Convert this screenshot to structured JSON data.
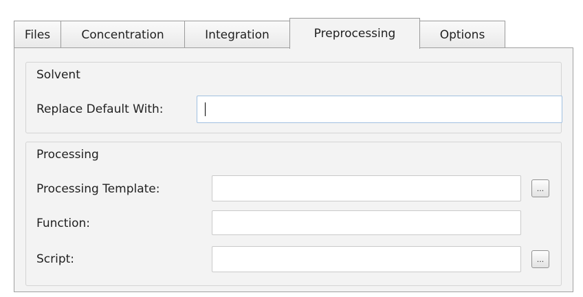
{
  "tabs": [
    {
      "label": "Files",
      "active": false
    },
    {
      "label": "Concentration",
      "active": false
    },
    {
      "label": "Integration",
      "active": false
    },
    {
      "label": "Preprocessing",
      "active": true
    },
    {
      "label": "Options",
      "active": false
    }
  ],
  "solvent": {
    "title": "Solvent",
    "replace_label": "Replace Default With:",
    "replace_value": ""
  },
  "processing": {
    "title": "Processing",
    "template_label": "Processing Template:",
    "template_value": "",
    "function_label": "Function:",
    "function_value": "",
    "script_label": "Script:",
    "script_value": "",
    "browse_label": "..."
  },
  "icons": {
    "browse": "ellipsis-browse-icon"
  }
}
